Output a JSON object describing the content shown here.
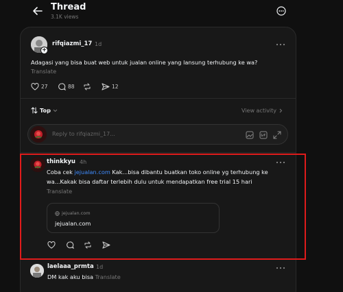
{
  "header": {
    "title": "Thread",
    "views": "3.1K views"
  },
  "post": {
    "username": "rifqiazmi_17",
    "time": "1d",
    "text": "Adagasi yang bisa buat web untuk jualan online yang lansung terhubung ke wa?",
    "translate": "Translate",
    "likes": "27",
    "comments": "88",
    "shares": "12"
  },
  "sort": {
    "label": "Top",
    "view_activity": "View activity"
  },
  "reply": {
    "placeholder": "Reply to rifqiazmi_17..."
  },
  "comment": {
    "username": "thinkkyu",
    "time": "4h",
    "text_before": "Coba cek ",
    "link": "jejualan.com",
    "text_after": " Kak...bisa dibantu buatkan toko online yg terhubung ke wa...Kakak bisa daftar terlebih dulu untuk mendapatkan free trial 15 hari",
    "translate": "Translate",
    "preview_domain": "jejualan.com",
    "preview_title": "jejualan.com"
  },
  "reply2": {
    "username": "laelaaa_prmta",
    "time": "1d",
    "text": "DM kak aku bisa",
    "translate": "Translate"
  },
  "colors": {
    "highlight": "#e01b1b",
    "link": "#3f8cff",
    "background": "#101010"
  }
}
